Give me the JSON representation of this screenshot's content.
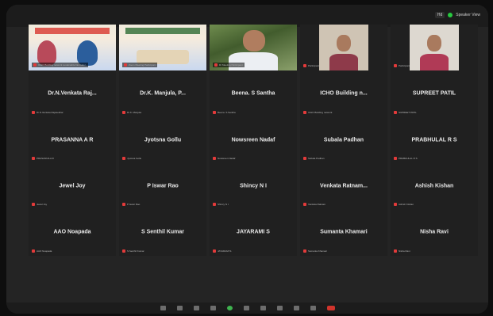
{
  "meeting": {
    "status_pad": "Hd",
    "status_label": "Speaker View"
  },
  "video_tiles": [
    {
      "footer": "ICHO Building network sustainable bio-mater.."
    },
    {
      "footer": "Zoom Meeting Participant"
    },
    {
      "footer": "Dr Meeting Participant"
    },
    {
      "footer": "Participant"
    },
    {
      "footer": "Participant"
    }
  ],
  "participants": [
    {
      "name": "Dr.N.Venkata Raj...",
      "sub": "Dr.N.Venkata Rajasekhar"
    },
    {
      "name": "Dr.K. Manjula, P...",
      "sub": "Dr.K. Manjula"
    },
    {
      "name": "Beena. S Santha",
      "sub": "Beena. S Santha"
    },
    {
      "name": "ICHO Building n...",
      "sub": "ICHO Building network"
    },
    {
      "name": "SUPREET PATIL",
      "sub": "SUPREET PATIL"
    },
    {
      "name": "PRASANNA A R",
      "sub": "PRASANNA A R"
    },
    {
      "name": "Jyotsna Gollu",
      "sub": "Jyotsna Gollu"
    },
    {
      "name": "Nowsreen Nadaf",
      "sub": "Nowsreen Nadaf"
    },
    {
      "name": "Subala Padhan",
      "sub": "Subala Padhan"
    },
    {
      "name": "PRABHULAL R S",
      "sub": "PRABHULAL R S"
    },
    {
      "name": "Jewel Joy",
      "sub": "Jewel Joy"
    },
    {
      "name": "P Iswar Rao",
      "sub": "P Iswar Rao"
    },
    {
      "name": "Shincy N I",
      "sub": "Shincy N I"
    },
    {
      "name": "Venkata Ratnam...",
      "sub": "Venkata Ratnam"
    },
    {
      "name": "Ashish Kishan",
      "sub": "Ashish Kishan"
    },
    {
      "name": "AAO Noapada",
      "sub": "AAO Noapada"
    },
    {
      "name": "S Senthil Kumar",
      "sub": "S Senthil Kumar"
    },
    {
      "name": "JAYARAMI S",
      "sub": "JAYARAMI S"
    },
    {
      "name": "Sumanta Khamari",
      "sub": "Sumanta Khamari"
    },
    {
      "name": "Nisha Ravi",
      "sub": "Nisha Ravi"
    }
  ],
  "toolbar_icons": [
    "mute-icon",
    "video-icon",
    "security-icon",
    "participants-icon",
    "chat-icon",
    "share-screen-icon",
    "record-icon",
    "reactions-icon",
    "apps-icon",
    "more-icon",
    "leave-icon"
  ],
  "colors": {
    "background": "#242424",
    "mic_off": "#e23a3a",
    "status_green": "#27c93f"
  }
}
